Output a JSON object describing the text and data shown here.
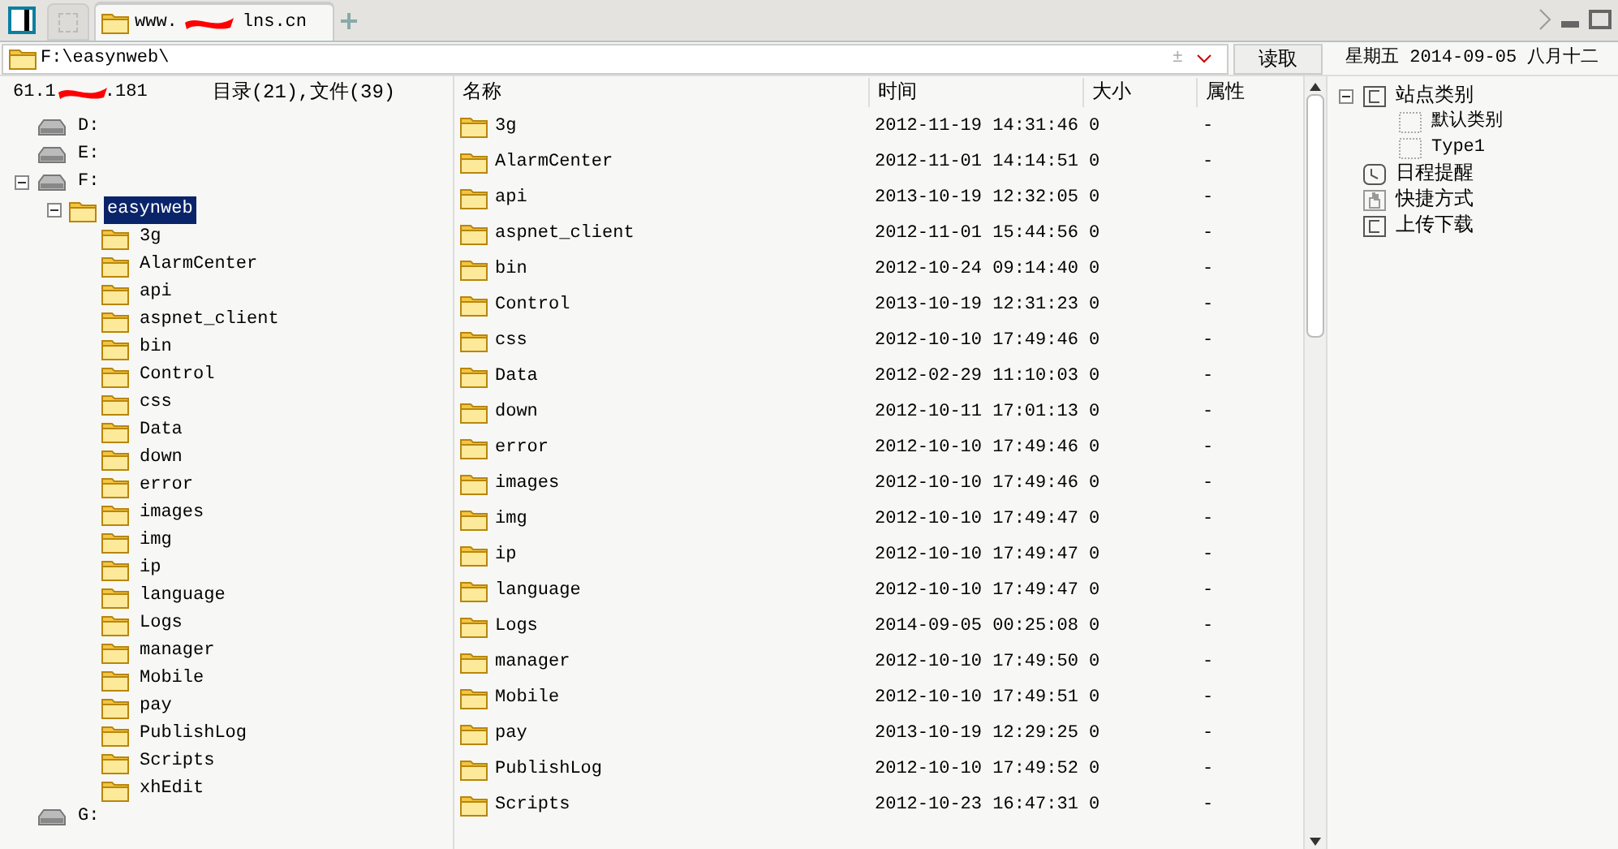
{
  "tabs": [
    {
      "kind": "panel",
      "selected": false
    },
    {
      "kind": "blank",
      "selected": false
    },
    {
      "kind": "site",
      "title_start": "www.",
      "title_end": "lns.cn",
      "selected": true
    }
  ],
  "address": {
    "value": "F:\\easynweb\\",
    "plus_minus": "±",
    "read_button": "读取"
  },
  "date_line": "星期五 2014-09-05 八月十二",
  "server": {
    "ip_start": "61.1",
    "ip_end": ".181",
    "summary": "目录(21),文件(39)"
  },
  "tree": [
    {
      "label": "D:",
      "kind": "drive",
      "selected": false
    },
    {
      "label": "E:",
      "kind": "drive",
      "selected": false
    },
    {
      "label": "F:",
      "kind": "drive",
      "expanded": true,
      "selected": false,
      "children": [
        {
          "label": "easynweb",
          "kind": "folder",
          "expanded": true,
          "selected": true,
          "children": [
            {
              "label": "3g",
              "kind": "folder",
              "selected": false
            },
            {
              "label": "AlarmCenter",
              "kind": "folder",
              "selected": false
            },
            {
              "label": "api",
              "kind": "folder",
              "selected": false
            },
            {
              "label": "aspnet_client",
              "kind": "folder",
              "selected": false
            },
            {
              "label": "bin",
              "kind": "folder",
              "selected": false
            },
            {
              "label": "Control",
              "kind": "folder",
              "selected": false
            },
            {
              "label": "css",
              "kind": "folder",
              "selected": false
            },
            {
              "label": "Data",
              "kind": "folder",
              "selected": false
            },
            {
              "label": "down",
              "kind": "folder",
              "selected": false
            },
            {
              "label": "error",
              "kind": "folder",
              "selected": false
            },
            {
              "label": "images",
              "kind": "folder",
              "selected": false
            },
            {
              "label": "img",
              "kind": "folder",
              "selected": false
            },
            {
              "label": "ip",
              "kind": "folder",
              "selected": false
            },
            {
              "label": "language",
              "kind": "folder",
              "selected": false
            },
            {
              "label": "Logs",
              "kind": "folder",
              "selected": false
            },
            {
              "label": "manager",
              "kind": "folder",
              "selected": false
            },
            {
              "label": "Mobile",
              "kind": "folder",
              "selected": false
            },
            {
              "label": "pay",
              "kind": "folder",
              "selected": false
            },
            {
              "label": "PublishLog",
              "kind": "folder",
              "selected": false
            },
            {
              "label": "Scripts",
              "kind": "folder",
              "selected": false
            },
            {
              "label": "xhEdit",
              "kind": "folder",
              "selected": false
            }
          ]
        }
      ]
    },
    {
      "label": "G:",
      "kind": "drive",
      "selected": false
    }
  ],
  "table": {
    "columns": [
      "名称",
      "时间",
      "大小",
      "属性"
    ],
    "rows": [
      [
        "3g",
        "2012-11-19 14:31:46",
        "0",
        "-"
      ],
      [
        "AlarmCenter",
        "2012-11-01 14:14:51",
        "0",
        "-"
      ],
      [
        "api",
        "2013-10-19 12:32:05",
        "0",
        "-"
      ],
      [
        "aspnet_client",
        "2012-11-01 15:44:56",
        "0",
        "-"
      ],
      [
        "bin",
        "2012-10-24 09:14:40",
        "0",
        "-"
      ],
      [
        "Control",
        "2013-10-19 12:31:23",
        "0",
        "-"
      ],
      [
        "css",
        "2012-10-10 17:49:46",
        "0",
        "-"
      ],
      [
        "Data",
        "2012-02-29 11:10:03",
        "0",
        "-"
      ],
      [
        "down",
        "2012-10-11 17:01:13",
        "0",
        "-"
      ],
      [
        "error",
        "2012-10-10 17:49:46",
        "0",
        "-"
      ],
      [
        "images",
        "2012-10-10 17:49:46",
        "0",
        "-"
      ],
      [
        "img",
        "2012-10-10 17:49:47",
        "0",
        "-"
      ],
      [
        "ip",
        "2012-10-10 17:49:47",
        "0",
        "-"
      ],
      [
        "language",
        "2012-10-10 17:49:47",
        "0",
        "-"
      ],
      [
        "Logs",
        "2014-09-05 00:25:08",
        "0",
        "-"
      ],
      [
        "manager",
        "2012-10-10 17:49:50",
        "0",
        "-"
      ],
      [
        "Mobile",
        "2012-10-10 17:49:51",
        "0",
        "-"
      ],
      [
        "pay",
        "2013-10-19 12:29:25",
        "0",
        "-"
      ],
      [
        "PublishLog",
        "2012-10-10 17:49:52",
        "0",
        "-"
      ],
      [
        "Scripts",
        "2012-10-23 16:47:31",
        "0",
        "-"
      ]
    ]
  },
  "side_tree": [
    {
      "label": "站点类别",
      "kind": "category",
      "expanded": true,
      "children": [
        {
          "label": "默认类别",
          "kind": "item"
        },
        {
          "label": "Type1",
          "kind": "item"
        }
      ]
    },
    {
      "label": "日程提醒",
      "kind": "schedule"
    },
    {
      "label": "快捷方式",
      "kind": "shortcut"
    },
    {
      "label": "上传下载",
      "kind": "transfer"
    }
  ]
}
